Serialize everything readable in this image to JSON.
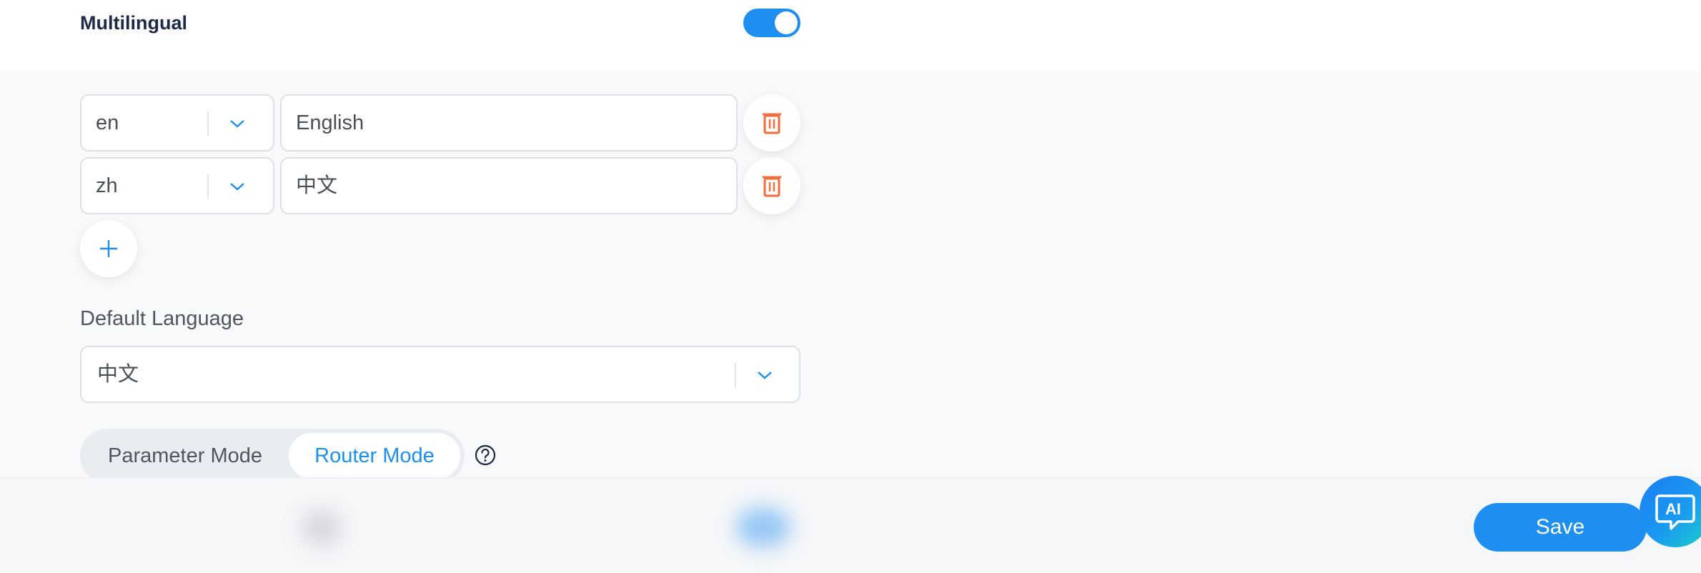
{
  "multilingual": {
    "label": "Multilingual",
    "enabled": true
  },
  "languages": [
    {
      "code": "en",
      "name": "English"
    },
    {
      "code": "zh",
      "name": "中文"
    }
  ],
  "default_language": {
    "label": "Default Language",
    "value": "中文"
  },
  "mode": {
    "options": [
      "Parameter Mode",
      "Router Mode"
    ],
    "selected": "Router Mode"
  },
  "footer": {
    "save_label": "Save",
    "ai_label": "AI"
  },
  "colors": {
    "accent": "#1e8ff0",
    "danger": "#f26d3d"
  }
}
